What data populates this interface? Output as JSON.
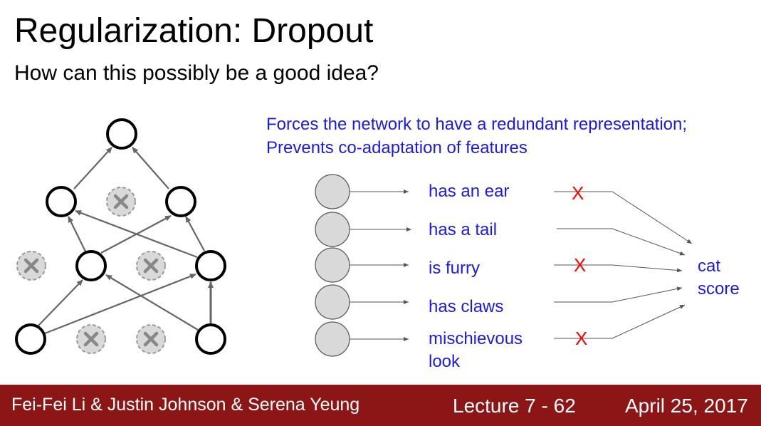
{
  "slide": {
    "title": "Regularization: Dropout",
    "subtitle": "How can this possibly be a good idea?"
  },
  "note": {
    "line1": "Forces the network to have a redundant representation;",
    "line2": "Prevents co-adaptation of features"
  },
  "features": [
    {
      "label": "has an ear",
      "dropped": true
    },
    {
      "label": "has a tail",
      "dropped": false
    },
    {
      "label": "is furry",
      "dropped": true
    },
    {
      "label": "has claws",
      "dropped": false
    },
    {
      "label": "mischievous",
      "label2": "look",
      "dropped": true
    }
  ],
  "drop_mark": "X",
  "output": {
    "line1": "cat",
    "line2": "score"
  },
  "colors": {
    "footer_bg": "#8c1515",
    "note_text": "#1a1ae6",
    "drop_mark": "#ff0000",
    "dropped_node_fill": "#d9d9d9"
  },
  "footer": {
    "authors": "Fei-Fei Li & Justin Johnson & Serena Yeung",
    "lecture": "Lecture 7 - 62",
    "date": "April 25, 2017"
  }
}
